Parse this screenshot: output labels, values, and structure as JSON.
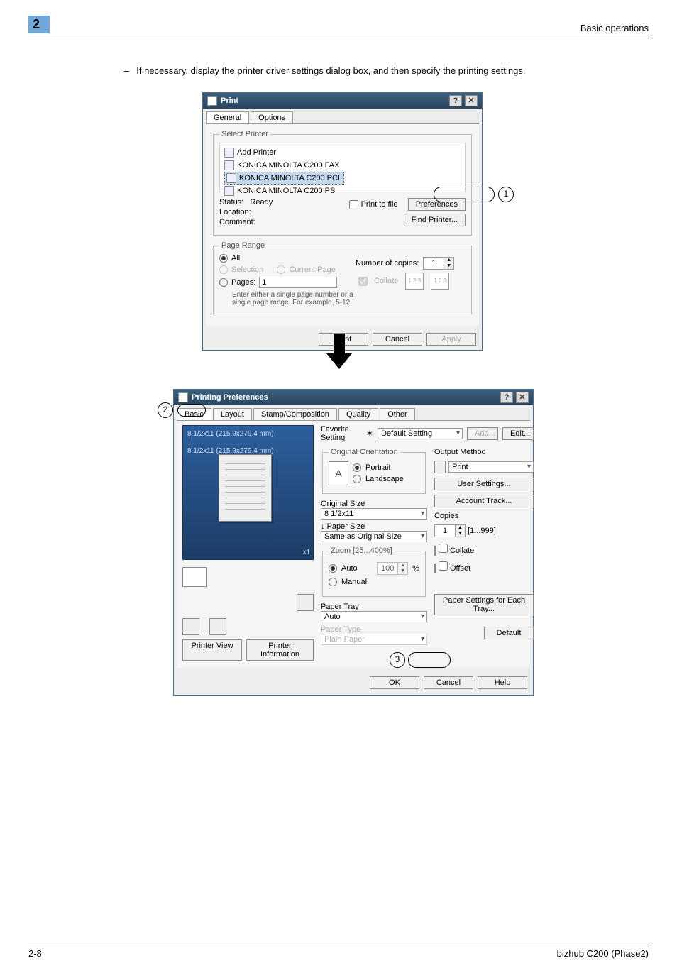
{
  "header": {
    "chapter": "2",
    "section": "Basic operations"
  },
  "intro": "If necessary, display the printer driver settings dialog box, and then specify the printing settings.",
  "callouts": {
    "one": "1",
    "two": "2",
    "three": "3"
  },
  "dlgPrint": {
    "title": "Print",
    "tabs": [
      "General",
      "Options"
    ],
    "selectPrinter": {
      "legend": "Select Printer",
      "items": [
        "Add Printer",
        "KONICA MINOLTA C200 FAX",
        "KONICA MINOLTA C200 PCL",
        "KONICA MINOLTA C200 PS"
      ],
      "selectedIndex": 2
    },
    "status": {
      "labels": {
        "status": "Status:",
        "location": "Location:",
        "comment": "Comment:"
      },
      "value": "Ready",
      "printToFile": "Print to file",
      "preferences": "Preferences",
      "findPrinter": "Find Printer..."
    },
    "pageRange": {
      "legend": "Page Range",
      "all": "All",
      "selection": "Selection",
      "currentPage": "Current Page",
      "pages": "Pages:",
      "pagesValue": "1",
      "hint": "Enter either a single page number or a single page range.  For example, 5-12",
      "copiesLabel": "Number of copies:",
      "copiesValue": "1",
      "collate": "Collate"
    },
    "footer": {
      "print": "Print",
      "cancel": "Cancel",
      "apply": "Apply"
    }
  },
  "dlgPrefs": {
    "title": "Printing Preferences",
    "tabs": [
      "Basic",
      "Layout",
      "Stamp/Composition",
      "Quality",
      "Other"
    ],
    "preview": {
      "line1": "8 1/2x11 (215.9x279.4 mm)",
      "line2": "8 1/2x11 (215.9x279.4 mm)",
      "scale": "x1"
    },
    "leftButtons": {
      "printerView": "Printer View",
      "printerInfo": "Printer Information"
    },
    "favorite": {
      "label": "Favorite Setting",
      "value": "Default Setting",
      "add": "Add...",
      "edit": "Edit..."
    },
    "orientation": {
      "legend": "Original Orientation",
      "portrait": "Portrait",
      "landscape": "Landscape"
    },
    "originalSize": {
      "label": "Original Size",
      "value": "8 1/2x11"
    },
    "paperSize": {
      "label": "Paper Size",
      "value": "Same as Original Size"
    },
    "zoom": {
      "legend": "Zoom [25...400%]",
      "auto": "Auto",
      "manual": "Manual",
      "value": "100",
      "pct": "%"
    },
    "paperTray": {
      "label": "Paper Tray",
      "value": "Auto"
    },
    "paperType": {
      "label": "Paper Type",
      "value": "Plain Paper"
    },
    "outputMethod": {
      "label": "Output Method",
      "value": "Print"
    },
    "right": {
      "userSettings": "User Settings...",
      "accountTrack": "Account Track...",
      "copiesLabel": "Copies",
      "copiesValue": "1",
      "copiesRange": "[1...999]",
      "collate": "Collate",
      "offset": "Offset",
      "paperSettings": "Paper Settings for Each Tray...",
      "default": "Default"
    },
    "footer": {
      "ok": "OK",
      "cancel": "Cancel",
      "help": "Help"
    }
  },
  "pageFooter": {
    "left": "2-8",
    "right": "bizhub C200 (Phase2)"
  }
}
